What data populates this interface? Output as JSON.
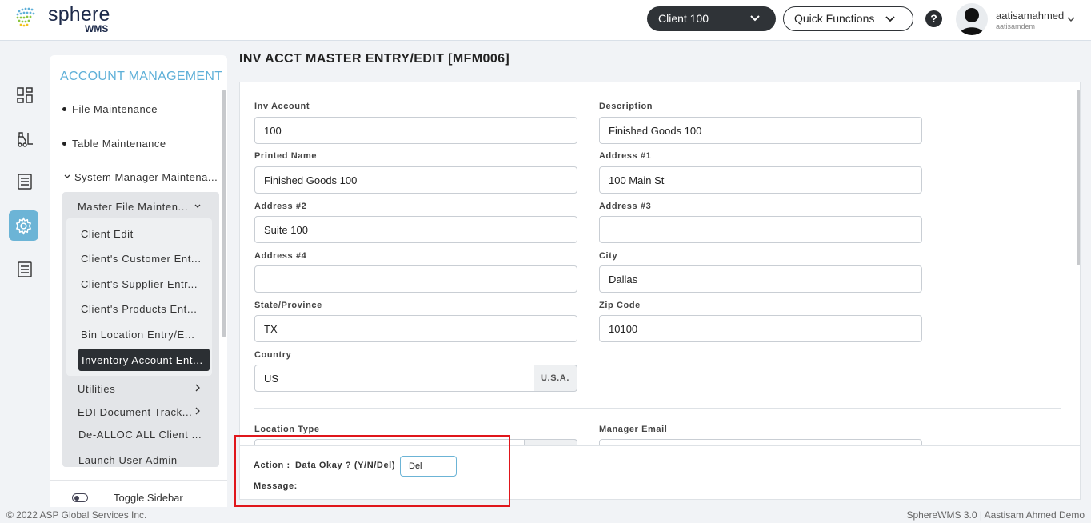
{
  "header": {
    "logo_text": "sphere",
    "logo_sub": "WMS",
    "client": "Client 100",
    "quick_functions": "Quick Functions",
    "help": "?",
    "username": "aatisamahmed",
    "usersub": "aatisamdem"
  },
  "sidebar": {
    "title": "ACCOUNT MANAGEMENT",
    "file_maintenance": "File Maintenance",
    "table_maintenance": "Table Maintenance",
    "system_manager": "System Manager Maintena...",
    "master_file": "Master File Mainten...",
    "sub_items": [
      "Client Edit",
      "Client's Customer Ent...",
      "Client's Supplier Entr...",
      "Client's Products Ent...",
      "Bin Location Entry/E..."
    ],
    "active_item": "Inventory Account Ent...",
    "utilities": "Utilities",
    "edi": "EDI Document Track...",
    "dealloc": "De-ALLOC ALL Client ...",
    "launch_admin": "Launch User Admin",
    "toggle": "Toggle Sidebar"
  },
  "main": {
    "title": "INV ACCT MASTER ENTRY/EDIT [MFM006]",
    "fields": {
      "inv_account": {
        "label": "Inv Account",
        "value": "100"
      },
      "description": {
        "label": "Description",
        "value": "Finished Goods 100"
      },
      "printed_name": {
        "label": "Printed Name",
        "value": "Finished Goods 100"
      },
      "address1": {
        "label": "Address #1",
        "value": "100 Main St"
      },
      "address2": {
        "label": "Address #2",
        "value": "Suite 100"
      },
      "address3": {
        "label": "Address #3",
        "value": ""
      },
      "address4": {
        "label": "Address #4",
        "value": ""
      },
      "city": {
        "label": "City",
        "value": "Dallas"
      },
      "state": {
        "label": "State/Province",
        "value": "TX"
      },
      "zip": {
        "label": "Zip Code",
        "value": "10100"
      },
      "country": {
        "label": "Country",
        "value": "US",
        "addon": "U.S.A."
      },
      "location_type": {
        "label": "Location Type"
      },
      "manager_email": {
        "label": "Manager Email"
      }
    }
  },
  "action": {
    "label": "Action :",
    "prompt": "Data Okay ? (Y/N/Del)",
    "value": "Del",
    "message_label": "Message:"
  },
  "footer": {
    "left": "© 2022 ASP Global Services Inc.",
    "right": "SphereWMS 3.0 | Aastisam Ahmed Demo"
  }
}
